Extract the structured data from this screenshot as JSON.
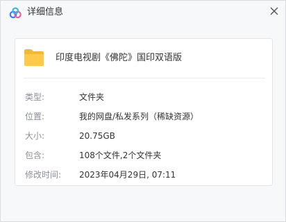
{
  "window": {
    "title": "详细信息",
    "close_glyph": "✕"
  },
  "file": {
    "icon": "folder-icon",
    "name": "印度电视剧《佛陀》国印双语版"
  },
  "details": [
    {
      "label": "类型:",
      "value": "文件夹"
    },
    {
      "label": "位置:",
      "value": "我的网盘/私发系列（稀缺资源）"
    },
    {
      "label": "大小:",
      "value": "20.75GB"
    },
    {
      "label": "包含:",
      "value": "108个文件,2个文件夹"
    },
    {
      "label": "修改时间:",
      "value": "2023年04月29日, 07:11"
    }
  ],
  "colors": {
    "folder": "#f5b82e",
    "logo_blue": "#3e7bf7",
    "logo_pink": "#f0609e"
  }
}
